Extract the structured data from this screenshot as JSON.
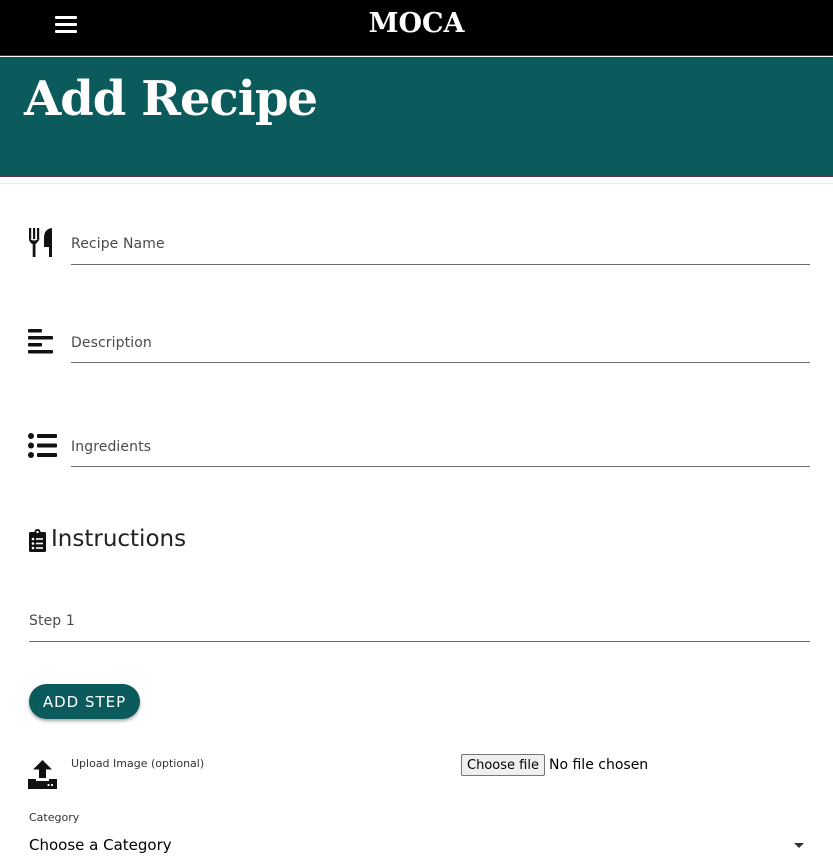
{
  "header": {
    "brand": "MOCA",
    "menu_icon": "hamburger-menu-icon"
  },
  "hero": {
    "title": "Add Recipe"
  },
  "form": {
    "recipe_name": {
      "label": "Recipe Name",
      "value": "",
      "icon": "utensils-icon"
    },
    "description": {
      "label": "Description",
      "value": "",
      "icon": "align-left-icon"
    },
    "ingredients": {
      "label": "Ingredients",
      "value": "",
      "icon": "list-icon"
    },
    "instructions": {
      "title": "Instructions",
      "icon": "clipboard-list-icon",
      "steps": [
        {
          "label": "Step 1",
          "value": ""
        }
      ],
      "add_step_label": "Add Step"
    },
    "upload": {
      "label": "Upload Image (optional)",
      "icon": "upload-icon",
      "button_label": "Choose file",
      "status": "No file chosen"
    },
    "category": {
      "label": "Category",
      "selected": "Choose a Category"
    }
  },
  "colors": {
    "topbar": "#000000",
    "accent": "#0b5b5d",
    "text": "#212121"
  }
}
